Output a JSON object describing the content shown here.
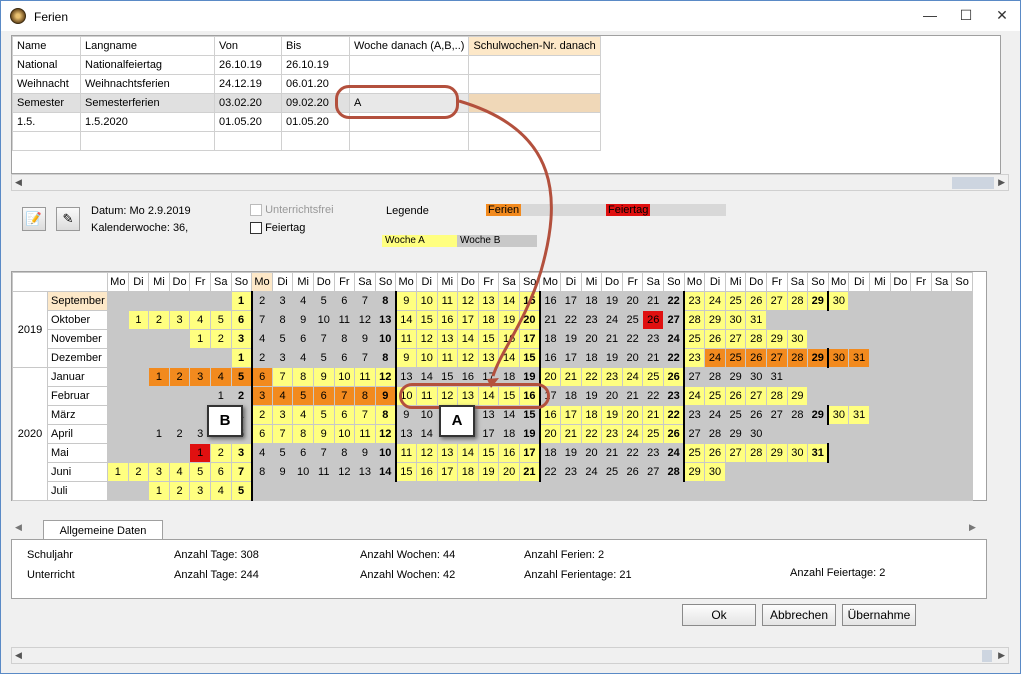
{
  "window": {
    "title": "Ferien"
  },
  "holidays": {
    "columns": [
      "Name",
      "Langname",
      "Von",
      "Bis",
      "Woche danach (A,B,..)",
      "Schulwochen-Nr. danach"
    ],
    "rows": [
      [
        "National",
        "Nationalfeiertag",
        "26.10.19",
        "26.10.19",
        "",
        ""
      ],
      [
        "Weihnacht",
        "Weihnachtsferien",
        "24.12.19",
        "06.01.20",
        "",
        ""
      ],
      [
        "Semester",
        "Semesterferien",
        "03.02.20",
        "09.02.20",
        "A",
        ""
      ],
      [
        "1.5.",
        "1.5.2020",
        "01.05.20",
        "01.05.20",
        "",
        ""
      ]
    ]
  },
  "info": {
    "datum": "Datum: Mo 2.9.2019",
    "kalenderwoche": "Kalenderwoche: 36,",
    "unterrichtsfrei": "Unterrichtsfrei",
    "feiertag": "Feiertag",
    "legende": "Legende",
    "ferien": "Ferien",
    "feiertag_legend": "Feiertag",
    "woche_a": "Woche A",
    "woche_b": "Woche B"
  },
  "calendar": {
    "weekdays": [
      "Mo",
      "Di",
      "Mi",
      "Do",
      "Fr",
      "Sa",
      "So",
      "Mo",
      "Di",
      "Mi",
      "Do",
      "Fr",
      "Sa",
      "So",
      "Mo",
      "Di",
      "Mi",
      "Do",
      "Fr",
      "Sa",
      "So",
      "Mo",
      "Di",
      "Mi",
      "Do",
      "Fr",
      "Sa",
      "So",
      "Mo",
      "Di",
      "Mi",
      "Do",
      "Fr",
      "Sa",
      "So",
      "Mo",
      "Di",
      "Mi",
      "Do",
      "Fr",
      "Sa",
      "So"
    ],
    "years": [
      {
        "label": "2019",
        "span": 4
      },
      {
        "label": "2020",
        "span": 7
      }
    ],
    "months": [
      {
        "name": "September",
        "start": 6,
        "days": 30,
        "classes": {}
      },
      {
        "name": "Oktober",
        "start": 1,
        "days": 31,
        "classes": {
          "26": "r"
        }
      },
      {
        "name": "November",
        "start": 4,
        "days": 30,
        "classes": {}
      },
      {
        "name": "Dezember",
        "start": 6,
        "days": 31,
        "classes": {
          "24": "f",
          "25": "f",
          "26": "f",
          "27": "f",
          "28": "f",
          "29": "f",
          "30": "f",
          "31": "f"
        }
      },
      {
        "name": "Januar",
        "start": 2,
        "days": 31,
        "classes": {
          "1": "f",
          "2": "f",
          "3": "f",
          "4": "f",
          "5": "f",
          "6": "f"
        }
      },
      {
        "name": "Februar",
        "start": 5,
        "days": 29,
        "classes": {
          "3": "f",
          "4": "f",
          "5": "f",
          "6": "f",
          "7": "f",
          "8": "f",
          "9": "f"
        }
      },
      {
        "name": "März",
        "start": 6,
        "days": 31,
        "classes": {}
      },
      {
        "name": "April",
        "start": 2,
        "days": 30,
        "classes": {}
      },
      {
        "name": "Mai",
        "start": 4,
        "days": 31,
        "classes": {
          "1": "r"
        }
      },
      {
        "name": "Juni",
        "start": 0,
        "days": 30,
        "classes": {}
      },
      {
        "name": "Juli",
        "start": 2,
        "days": 5,
        "classes": {}
      }
    ],
    "week_types": {
      "September": [
        "w",
        "g",
        "w",
        "g",
        "w"
      ],
      "Oktober": [
        "w",
        "g",
        "w",
        "g",
        "w"
      ],
      "November": [
        "w",
        "g",
        "w",
        "g",
        "w"
      ],
      "Dezember": [
        "w",
        "g",
        "w",
        "g",
        "w",
        "w"
      ],
      "Januar": [
        "w",
        "w",
        "g",
        "w",
        "g"
      ],
      "Februar": [
        "g",
        "g",
        "w",
        "g",
        "w"
      ],
      "März": [
        "g",
        "w",
        "g",
        "w",
        "g",
        "w"
      ],
      "April": [
        "g",
        "w",
        "g",
        "w",
        "g"
      ],
      "Mai": [
        "w",
        "g",
        "w",
        "g",
        "w"
      ],
      "Juni": [
        "w",
        "g",
        "w",
        "g",
        "w"
      ],
      "Juli": [
        "w"
      ]
    }
  },
  "tab": {
    "label": "Allgemeine Daten"
  },
  "stats": {
    "schuljahr": "Schuljahr",
    "unterricht": "Unterricht",
    "tage1": "Anzahl Tage: 308",
    "tage2": "Anzahl Tage: 244",
    "wochen1": "Anzahl Wochen: 44",
    "wochen2": "Anzahl Wochen: 42",
    "ferien": "Anzahl Ferien: 2",
    "ferientage": "Anzahl Ferientage: 21",
    "feiertage": "Anzahl Feiertage: 2"
  },
  "buttons": {
    "ok": "Ok",
    "cancel": "Abbrechen",
    "apply": "Übernahme"
  },
  "callouts": {
    "a": "A",
    "b": "B"
  },
  "colors": {
    "ferien": "#f28a1e",
    "feiertag": "#e01010",
    "woche_a": "#ffff80",
    "woche_b": "#c8c8c8",
    "callout": "#b3503d"
  }
}
